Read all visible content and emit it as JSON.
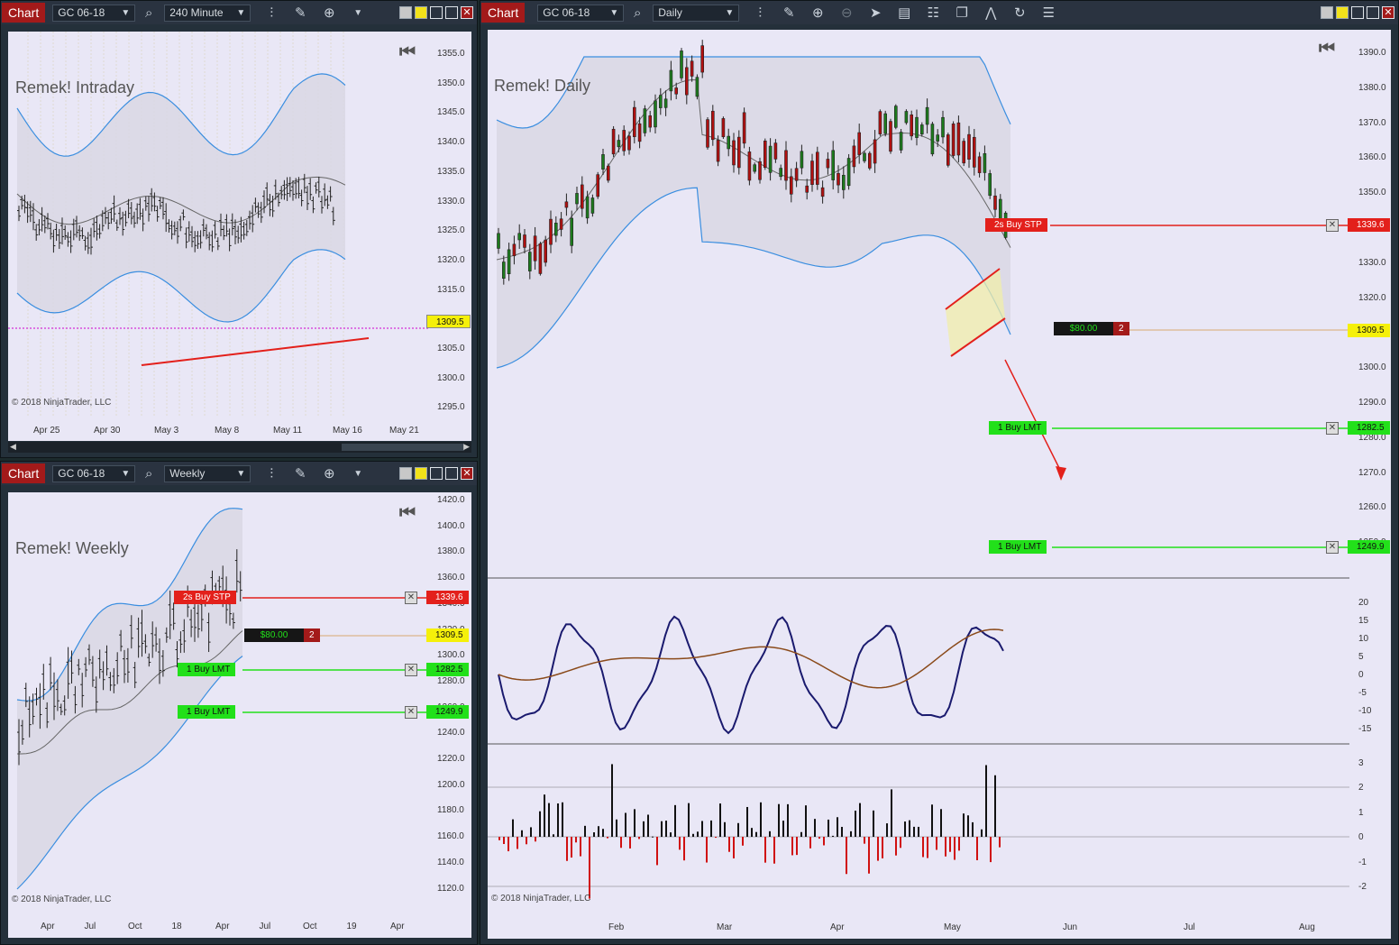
{
  "toolbar": {
    "chart_label": "Chart",
    "instrument": "GC 06-18"
  },
  "intraday": {
    "interval": "240 Minute",
    "title": "Remek! Intraday",
    "copyright": "© 2018 NinjaTrader, LLC",
    "y_ticks": [
      "1355.0",
      "1350.0",
      "1345.0",
      "1340.0",
      "1335.0",
      "1330.0",
      "1325.0",
      "1320.0",
      "1315.0",
      "1310.0",
      "1305.0",
      "1300.0",
      "1295.0"
    ],
    "x_ticks": [
      "Apr 25",
      "Apr 30",
      "May 3",
      "May 8",
      "May 11",
      "May 16",
      "May 21"
    ],
    "price_flag": "1309.5"
  },
  "weekly": {
    "interval": "Weekly",
    "title": "Remek! Weekly",
    "copyright": "© 2018 NinjaTrader, LLC",
    "y_ticks": [
      "1420.0",
      "1400.0",
      "1380.0",
      "1360.0",
      "1340.0",
      "1320.0",
      "1300.0",
      "1280.0",
      "1260.0",
      "1240.0",
      "1220.0",
      "1200.0",
      "1180.0",
      "1160.0",
      "1140.0",
      "1120.0"
    ],
    "x_ticks": [
      "Apr",
      "Jul",
      "Oct",
      "18",
      "Apr",
      "Jul",
      "Oct",
      "19",
      "Apr"
    ],
    "stop_label": "2s  Buy STP",
    "stop_price": "1339.6",
    "pnl": "$80.00",
    "pnl_qty": "2",
    "last_price": "1309.5",
    "lmt1_label": "1  Buy LMT",
    "lmt1_price": "1282.5",
    "lmt2_label": "1  Buy LMT",
    "lmt2_price": "1249.9"
  },
  "daily": {
    "interval": "Daily",
    "title": "Remek! Daily",
    "copyright": "© 2018 NinjaTrader, LLC",
    "y_ticks": [
      "1390.0",
      "1380.0",
      "1370.0",
      "1360.0",
      "1350.0",
      "1340.0",
      "1330.0",
      "1320.0",
      "1310.0",
      "1300.0",
      "1290.0",
      "1280.0",
      "1270.0",
      "1260.0",
      "1250.0"
    ],
    "osc_ticks": [
      "20",
      "15",
      "10",
      "5",
      "0",
      "-5",
      "-10",
      "-15"
    ],
    "hist_ticks": [
      "3",
      "2",
      "1",
      "0",
      "-1",
      "-2"
    ],
    "x_ticks": [
      "Feb",
      "Mar",
      "Apr",
      "May",
      "Jun",
      "Jul",
      "Aug"
    ],
    "stop_label": "2s  Buy STP",
    "stop_price": "1339.6",
    "pnl": "$80.00",
    "pnl_qty": "2",
    "last_price": "1309.5",
    "lmt1_label": "1  Buy LMT",
    "lmt1_price": "1282.5",
    "lmt2_label": "1  Buy LMT",
    "lmt2_price": "1249.9"
  },
  "colors": {
    "stop": "#e3201b",
    "limit": "#22e01a",
    "price": "#f5f00a",
    "band": "#3a8ee0",
    "up": "#1d7a1d",
    "down": "#b01010"
  }
}
